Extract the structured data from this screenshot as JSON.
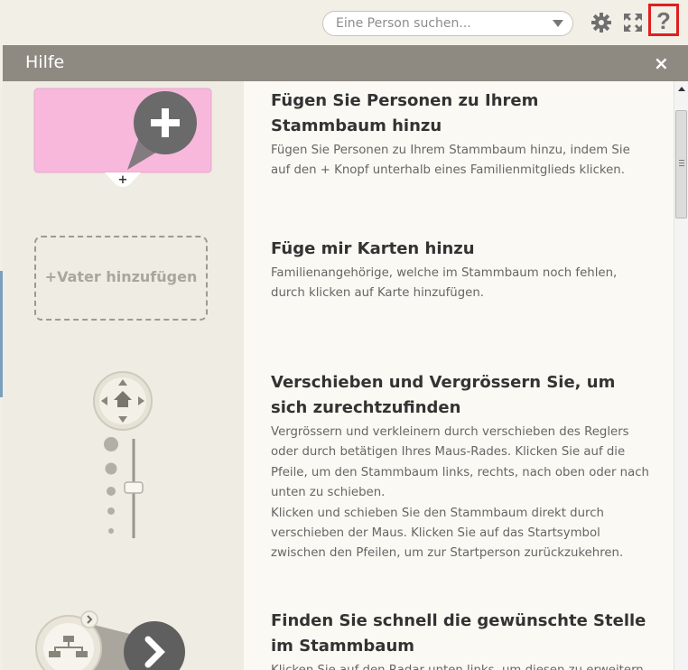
{
  "topbar": {
    "search": {
      "placeholder": "Eine Person suchen..."
    },
    "icons": {
      "settings": "gear-icon",
      "fullscreen": "fullscreen-icon",
      "help": "help-icon"
    },
    "help_label": "?"
  },
  "panel": {
    "title": "Hilfe",
    "close_label": "×",
    "sections": [
      {
        "title": "Fügen Sie Personen zu Ihrem Stammbaum hinzu",
        "body": "Fügen Sie Personen zu Ihrem Stammbaum hinzu, indem Sie auf den + Knopf unterhalb eines Familienmitglieds klicken."
      },
      {
        "title": "Füge mir Karten hinzu",
        "body": "Familienangehörige, welche im Stammbaum noch fehlen, durch klicken auf Karte hinzufügen."
      },
      {
        "title": "Verschieben und Vergrössern Sie, um sich zurechtzufinden",
        "body": "Vergrössern und verkleinern durch verschieben des Reglers oder durch betätigen Ihres Maus-Rades. Klicken Sie auf die Pfeile, um den Stammbaum links, rechts, nach oben oder nach unten zu schieben.",
        "body2": "Klicken und schieben Sie den Stammbaum direkt durch verschieben der Maus. Klicken Sie auf das Startsymbol zwischen den Pfeilen, um zur Startperson zurückzukehren."
      },
      {
        "title": "Finden Sie schnell die gewünschte Stelle im Stammbaum",
        "body": "Klicken Sie auf den Radar unten links, um diesen zu erweitern."
      }
    ],
    "illustrations": {
      "add_person_plus": "+",
      "add_father_card": "+Vater hinzufügen"
    }
  },
  "colors": {
    "header": "#8e8a82",
    "card_pink": "#f7b8dc",
    "accent_red": "#e01f1f"
  }
}
